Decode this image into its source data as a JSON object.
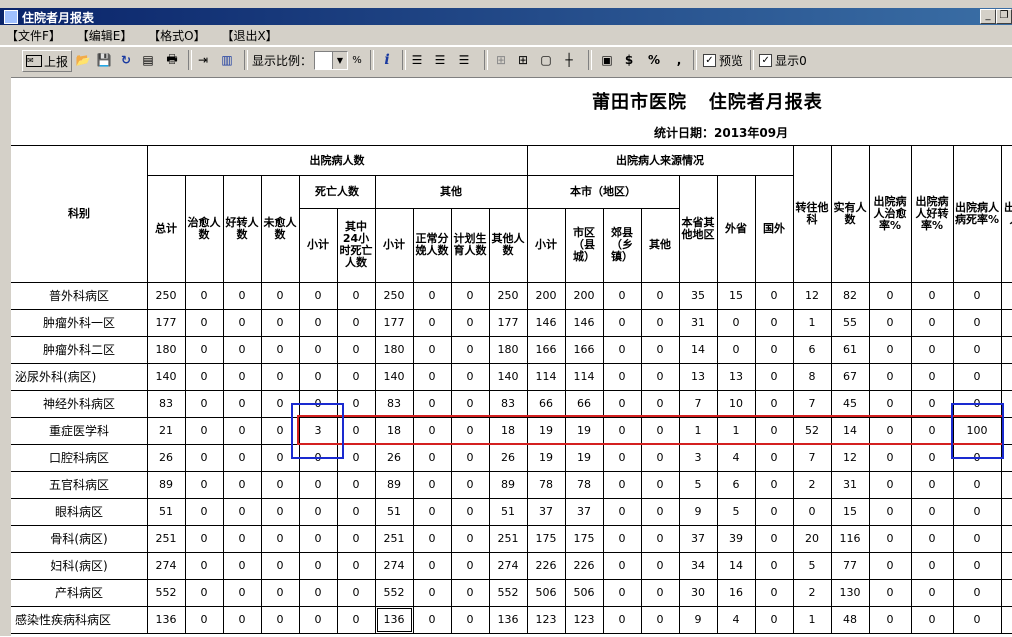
{
  "window": {
    "title": "住院者月报表"
  },
  "menu": [
    "【文件F】",
    "【编辑E】",
    "【格式O】",
    "【退出X】"
  ],
  "toolbar": {
    "report_label": "上报",
    "zoom_label": "显示比例：",
    "zoom_unit": "%",
    "info": "i",
    "dollar": "$",
    "percent": "%",
    "comma": ",",
    "preview_label": "预览",
    "show0_label": "显示0"
  },
  "report": {
    "title": "莆田市医院   住院者月报表",
    "date": "统计日期：2013年09月"
  },
  "headers": {
    "dept": "科别",
    "discharged": "出院病人数",
    "source": "出院病人来源情况",
    "total": "总计",
    "cured": "治愈人数",
    "improved": "好转人数",
    "uncured": "未愈人数",
    "death": "死亡人数",
    "death_sub": "小计",
    "death_24h": "其中24小时死亡人数",
    "other": "其他",
    "other_sub": "小计",
    "normal": "正常分娩人数",
    "planned": "计划生育人数",
    "other_cnt": "其他人数",
    "local": "本市（地区）",
    "local_sub": "小计",
    "city": "市区（县城）",
    "county": "郊县（乡镇）",
    "local_other": "其他",
    "province": "本省其他地区",
    "outside": "外省",
    "foreign": "国外",
    "transfer": "转往他科",
    "actual": "实有人数",
    "cure_rate": "出院病人治愈率%",
    "improve_rate": "出院病人好转率%",
    "death_rate": "出院病人病死率%",
    "last": "出院病人人"
  },
  "rows": [
    {
      "dept": "普外科病区",
      "v": [
        "250",
        "0",
        "0",
        "0",
        "0",
        "0",
        "250",
        "0",
        "0",
        "250",
        "200",
        "200",
        "0",
        "0",
        "35",
        "15",
        "0",
        "12",
        "82",
        "0",
        "0",
        "0"
      ]
    },
    {
      "dept": "肿瘤外科一区",
      "v": [
        "177",
        "0",
        "0",
        "0",
        "0",
        "0",
        "177",
        "0",
        "0",
        "177",
        "146",
        "146",
        "0",
        "0",
        "31",
        "0",
        "0",
        "1",
        "55",
        "0",
        "0",
        "0"
      ]
    },
    {
      "dept": "肿瘤外科二区",
      "v": [
        "180",
        "0",
        "0",
        "0",
        "0",
        "0",
        "180",
        "0",
        "0",
        "180",
        "166",
        "166",
        "0",
        "0",
        "14",
        "0",
        "0",
        "6",
        "61",
        "0",
        "0",
        "0"
      ]
    },
    {
      "dept": "泌尿外科(病区)",
      "v": [
        "140",
        "0",
        "0",
        "0",
        "0",
        "0",
        "140",
        "0",
        "0",
        "140",
        "114",
        "114",
        "0",
        "0",
        "13",
        "13",
        "0",
        "8",
        "67",
        "0",
        "0",
        "0"
      ]
    },
    {
      "dept": "神经外科病区",
      "v": [
        "83",
        "0",
        "0",
        "0",
        "0",
        "0",
        "83",
        "0",
        "0",
        "83",
        "66",
        "66",
        "0",
        "0",
        "7",
        "10",
        "0",
        "7",
        "45",
        "0",
        "0",
        "0"
      ]
    },
    {
      "dept": "重症医学科",
      "v": [
        "21",
        "0",
        "0",
        "0",
        "3",
        "0",
        "18",
        "0",
        "0",
        "18",
        "19",
        "19",
        "0",
        "0",
        "1",
        "1",
        "0",
        "52",
        "14",
        "0",
        "0",
        "100"
      ]
    },
    {
      "dept": "口腔科病区",
      "v": [
        "26",
        "0",
        "0",
        "0",
        "0",
        "0",
        "26",
        "0",
        "0",
        "26",
        "19",
        "19",
        "0",
        "0",
        "3",
        "4",
        "0",
        "7",
        "12",
        "0",
        "0",
        "0"
      ]
    },
    {
      "dept": "五官科病区",
      "v": [
        "89",
        "0",
        "0",
        "0",
        "0",
        "0",
        "89",
        "0",
        "0",
        "89",
        "78",
        "78",
        "0",
        "0",
        "5",
        "6",
        "0",
        "2",
        "31",
        "0",
        "0",
        "0"
      ]
    },
    {
      "dept": "眼科病区",
      "v": [
        "51",
        "0",
        "0",
        "0",
        "0",
        "0",
        "51",
        "0",
        "0",
        "51",
        "37",
        "37",
        "0",
        "0",
        "9",
        "5",
        "0",
        "0",
        "15",
        "0",
        "0",
        "0"
      ]
    },
    {
      "dept": "骨科(病区)",
      "v": [
        "251",
        "0",
        "0",
        "0",
        "0",
        "0",
        "251",
        "0",
        "0",
        "251",
        "175",
        "175",
        "0",
        "0",
        "37",
        "39",
        "0",
        "20",
        "116",
        "0",
        "0",
        "0"
      ]
    },
    {
      "dept": "妇科(病区)",
      "v": [
        "274",
        "0",
        "0",
        "0",
        "0",
        "0",
        "274",
        "0",
        "0",
        "274",
        "226",
        "226",
        "0",
        "0",
        "34",
        "14",
        "0",
        "5",
        "77",
        "0",
        "0",
        "0"
      ]
    },
    {
      "dept": "产科病区",
      "v": [
        "552",
        "0",
        "0",
        "0",
        "0",
        "0",
        "552",
        "0",
        "0",
        "552",
        "506",
        "506",
        "0",
        "0",
        "30",
        "16",
        "0",
        "2",
        "130",
        "0",
        "0",
        "0"
      ]
    },
    {
      "dept": "感染性疾病科病区",
      "v": [
        "136",
        "0",
        "0",
        "0",
        "0",
        "0",
        "136",
        "0",
        "0",
        "136",
        "123",
        "123",
        "0",
        "0",
        "9",
        "4",
        "0",
        "1",
        "48",
        "0",
        "0",
        "0"
      ]
    }
  ]
}
